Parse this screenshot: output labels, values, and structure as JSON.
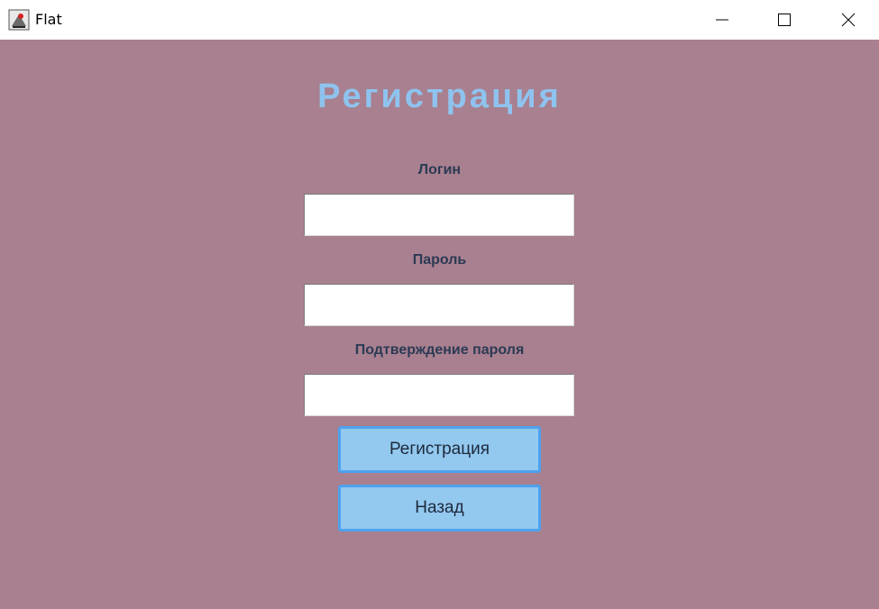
{
  "window": {
    "title": "Flat",
    "icon": "java-app-icon",
    "controls": [
      "minimize-icon",
      "maximize-icon",
      "close-icon"
    ]
  },
  "form": {
    "heading": "Регистрация",
    "login_label": "Логин",
    "login_value": "",
    "password_label": "Пароль",
    "password_value": "",
    "confirm_label": "Подтверждение пароля",
    "confirm_value": "",
    "register_button": "Регистрация",
    "back_button": "Назад"
  },
  "colors": {
    "background": "#a8808f",
    "heading": "#8fc3ef",
    "label": "#2c3a55",
    "button_fill": "#93c8ef",
    "button_border": "#4ea2ee"
  }
}
